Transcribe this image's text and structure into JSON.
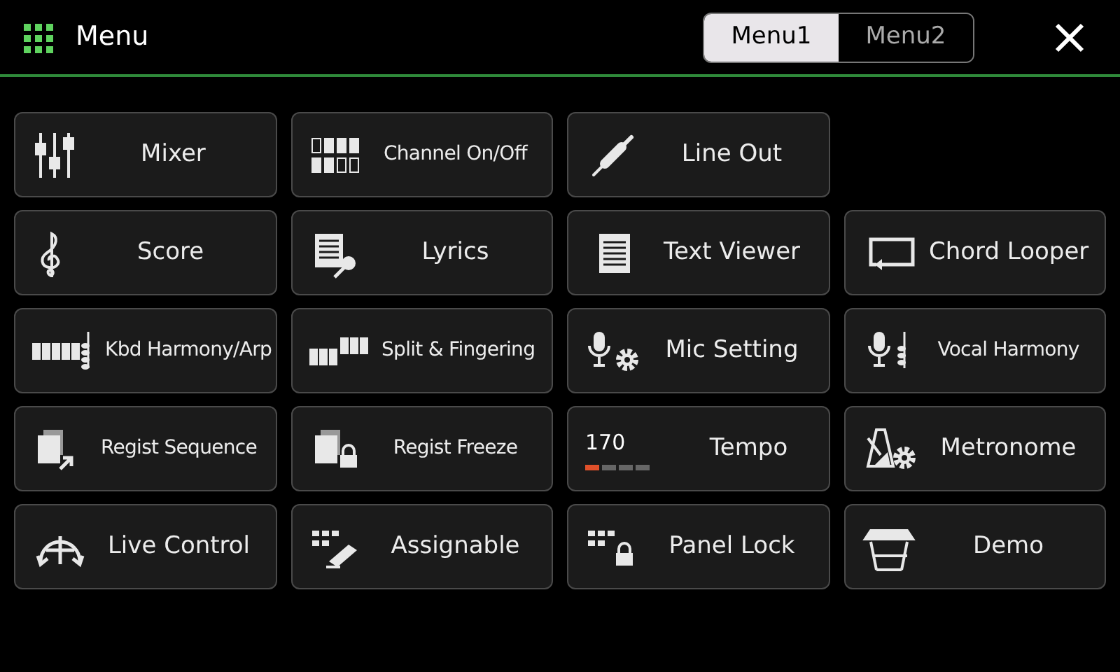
{
  "header": {
    "title": "Menu"
  },
  "tabs": [
    {
      "label": "Menu1",
      "selected": true
    },
    {
      "label": "Menu2",
      "selected": false
    }
  ],
  "rows": [
    [
      {
        "label": "Mixer"
      },
      {
        "label": "Channel On/Off"
      },
      {
        "label": "Line Out"
      }
    ],
    [
      {
        "label": "Score"
      },
      {
        "label": "Lyrics"
      },
      {
        "label": "Text Viewer"
      },
      {
        "label": "Chord Looper"
      }
    ],
    [
      {
        "label": "Kbd Harmony/Arp"
      },
      {
        "label": "Split & Fingering"
      },
      {
        "label": "Mic Setting"
      },
      {
        "label": "Vocal Harmony"
      }
    ],
    [
      {
        "label": "Regist Sequence"
      },
      {
        "label": "Regist Freeze"
      },
      {
        "kind": "tempo",
        "label": "Tempo",
        "bpm": "170",
        "beats": [
          {
            "on": true
          },
          {
            "on": false
          },
          {
            "on": false
          },
          {
            "on": false
          }
        ]
      },
      {
        "label": "Metronome"
      }
    ],
    [
      {
        "label": "Live Control"
      },
      {
        "label": "Assignable"
      },
      {
        "label": "Panel Lock"
      },
      {
        "label": "Demo"
      }
    ]
  ]
}
